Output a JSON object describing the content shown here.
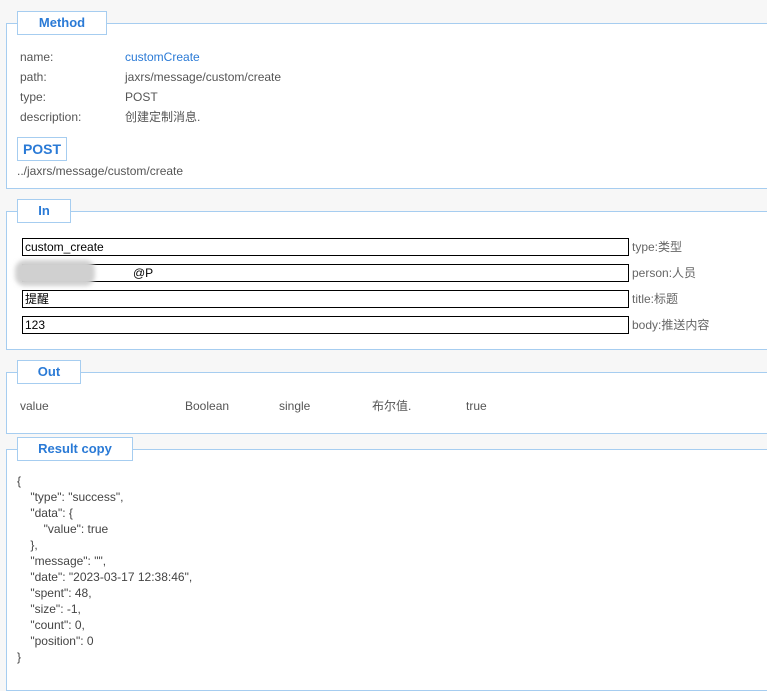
{
  "method": {
    "legend": "Method",
    "rows": [
      {
        "key": "name:",
        "value": "customCreate"
      },
      {
        "key": "path:",
        "value": "jaxrs/message/custom/create"
      },
      {
        "key": "type:",
        "value": "POST"
      },
      {
        "key": "description:",
        "value": "创建定制消息."
      }
    ],
    "verb_button": "POST",
    "url": "../jaxrs/message/custom/create"
  },
  "in": {
    "legend": "In",
    "fields": [
      {
        "value": "custom_create",
        "label": "type:类型"
      },
      {
        "value": "@P",
        "label": "person:人员"
      },
      {
        "value": "提醒",
        "label": "title:标题"
      },
      {
        "value": "123",
        "label": "body:推送内容"
      }
    ]
  },
  "out": {
    "legend": "Out",
    "row": {
      "name": "value",
      "type": "Boolean",
      "mode": "single",
      "desc": "布尔值.",
      "value": "true"
    }
  },
  "result": {
    "legend": "Result copy",
    "json": "{\n    \"type\": \"success\",\n    \"data\": {\n        \"value\": true\n    },\n    \"message\": \"\",\n    \"date\": \"2023-03-17 12:38:46\",\n    \"spent\": 48,\n    \"size\": -1,\n    \"count\": 0,\n    \"position\": 0\n}"
  },
  "colors": {
    "accent": "#2a7ad6",
    "border": "#a6cdf0"
  }
}
